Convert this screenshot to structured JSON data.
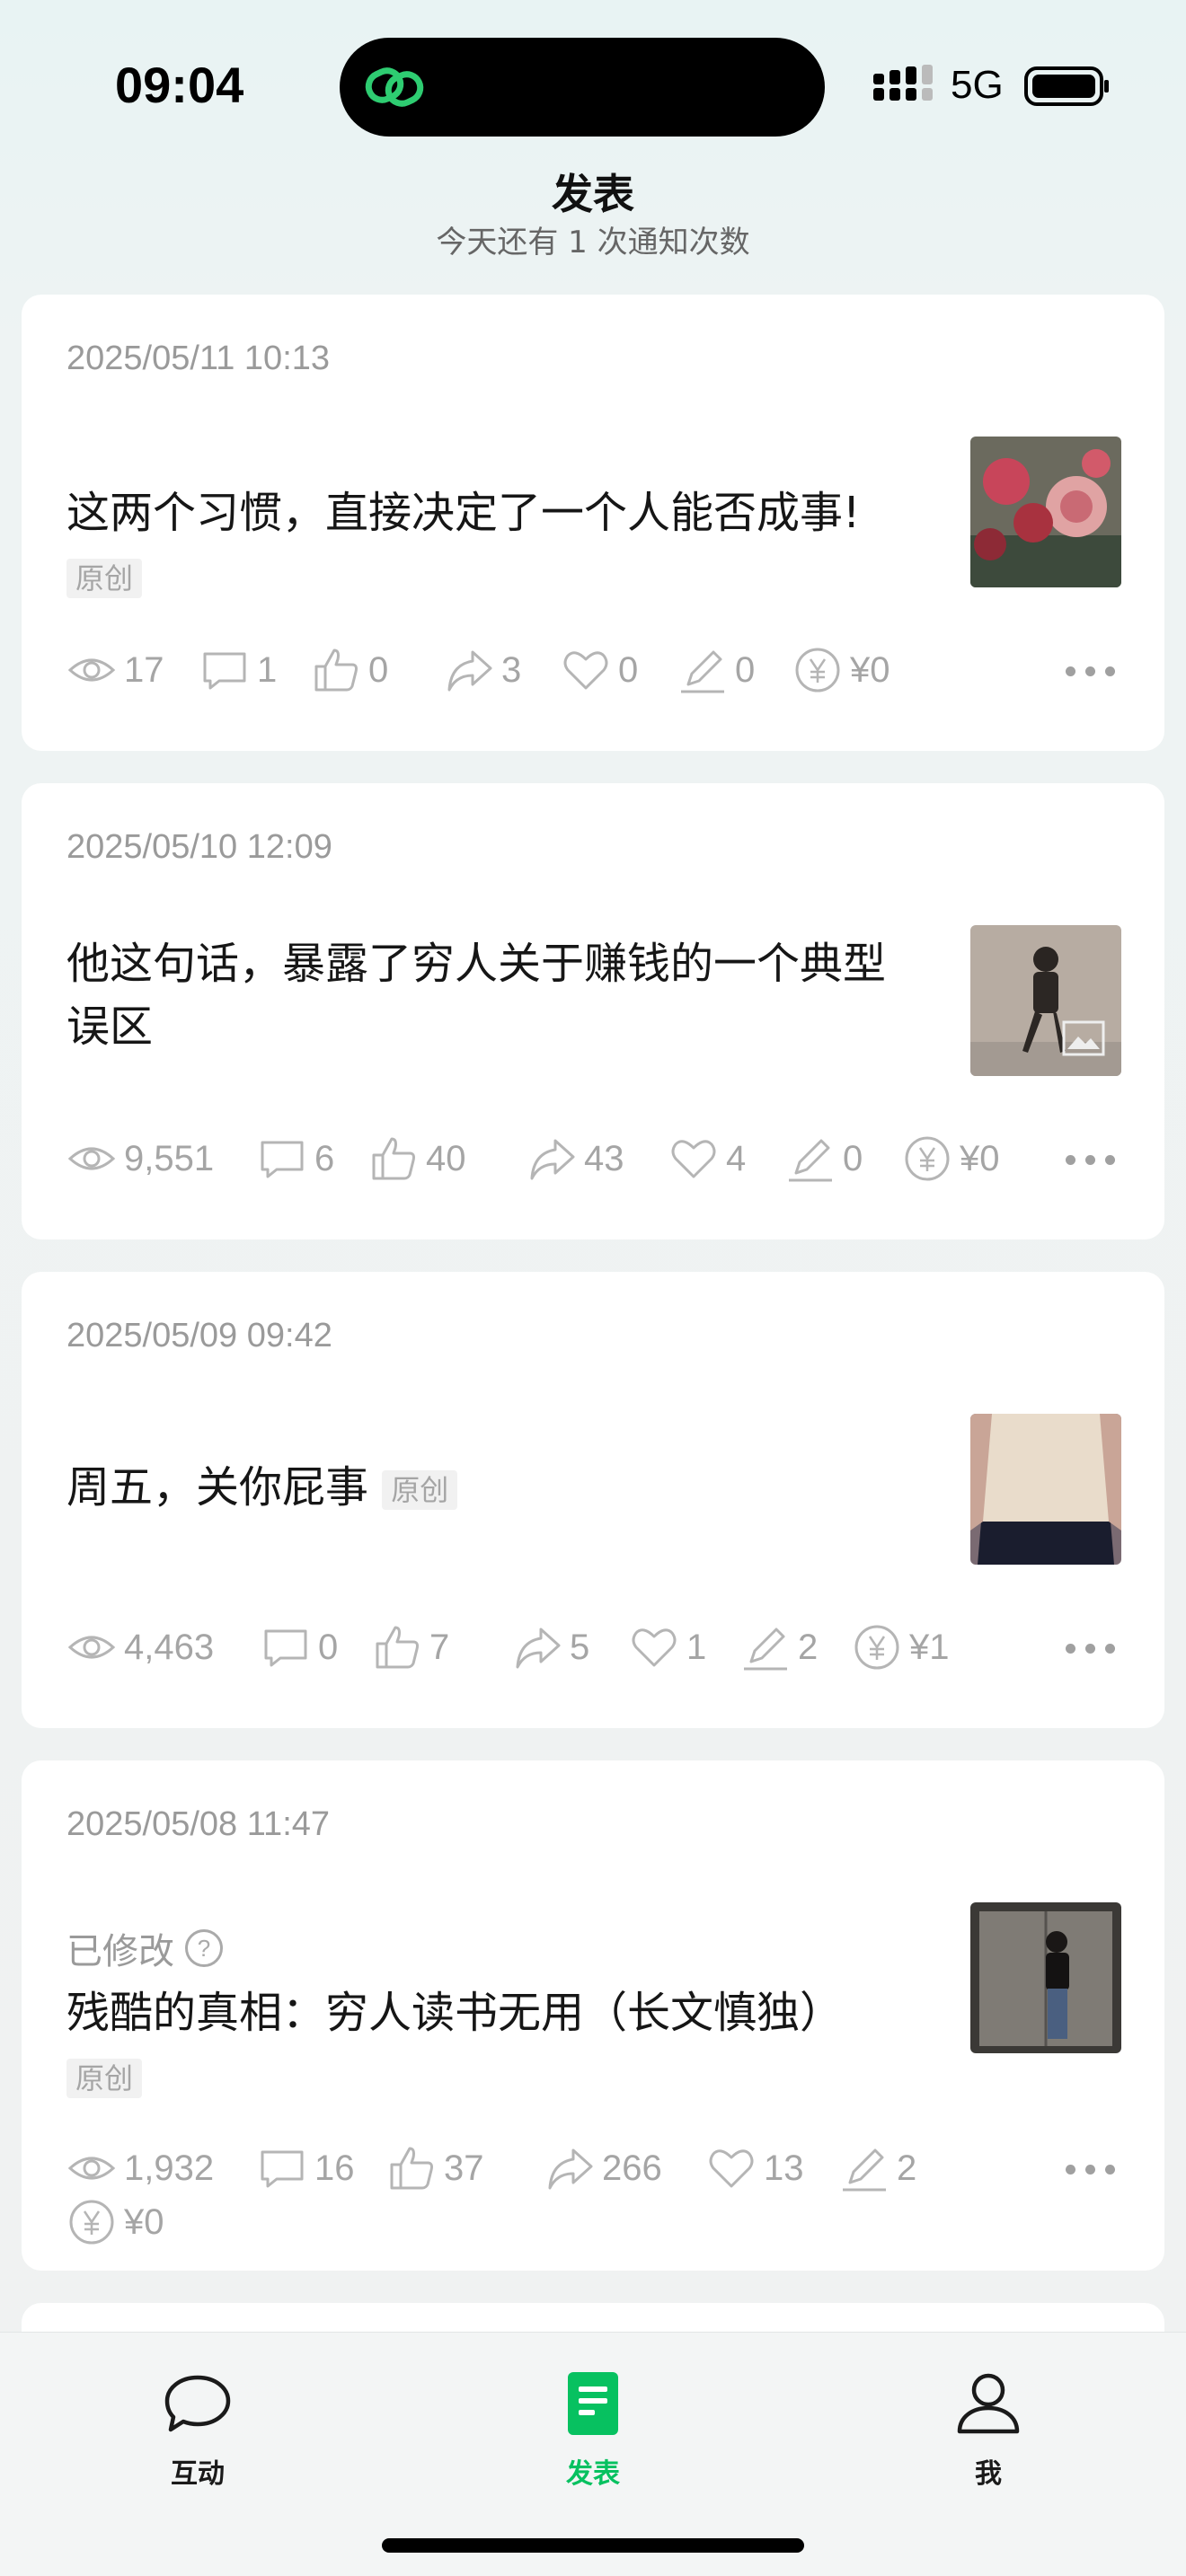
{
  "status_bar": {
    "time": "09:04",
    "network": "5G"
  },
  "header": {
    "title": "发表",
    "subtitle": "今天还有 1 次通知次数"
  },
  "posts": [
    {
      "date": "2025/05/11 10:13",
      "title": "这两个习惯，直接决定了一个人能否成事!",
      "tag": "原创",
      "stats": {
        "views": "17",
        "comments": "1",
        "likes": "0",
        "shares": "3",
        "favorites": "0",
        "edits": "0",
        "reward": "¥0"
      }
    },
    {
      "date": "2025/05/10 12:09",
      "title": "他这句话，暴露了穷人关于赚钱的一个典型误区",
      "stats": {
        "views": "9,551",
        "comments": "6",
        "likes": "40",
        "shares": "43",
        "favorites": "4",
        "edits": "0",
        "reward": "¥0"
      }
    },
    {
      "date": "2025/05/09 09:42",
      "title": "周五，关你屁事",
      "tag": "原创",
      "stats": {
        "views": "4,463",
        "comments": "0",
        "likes": "7",
        "shares": "5",
        "favorites": "1",
        "edits": "2",
        "reward": "¥1"
      }
    },
    {
      "date": "2025/05/08 11:47",
      "modified_label": "已修改",
      "title": "残酷的真相：穷人读书无用（长文慎独）",
      "tag": "原创",
      "stats": {
        "views": "1,932",
        "comments": "16",
        "likes": "37",
        "shares": "266",
        "favorites": "13",
        "edits": "2",
        "reward": "¥0"
      }
    }
  ],
  "tabbar": {
    "items": [
      {
        "label": "互动",
        "icon": "chat-bubble-icon"
      },
      {
        "label": "发表",
        "icon": "document-icon",
        "active": true
      },
      {
        "label": "我",
        "icon": "person-icon"
      }
    ]
  },
  "colors": {
    "accent": "#07c160",
    "muted": "#a5a5a5"
  }
}
